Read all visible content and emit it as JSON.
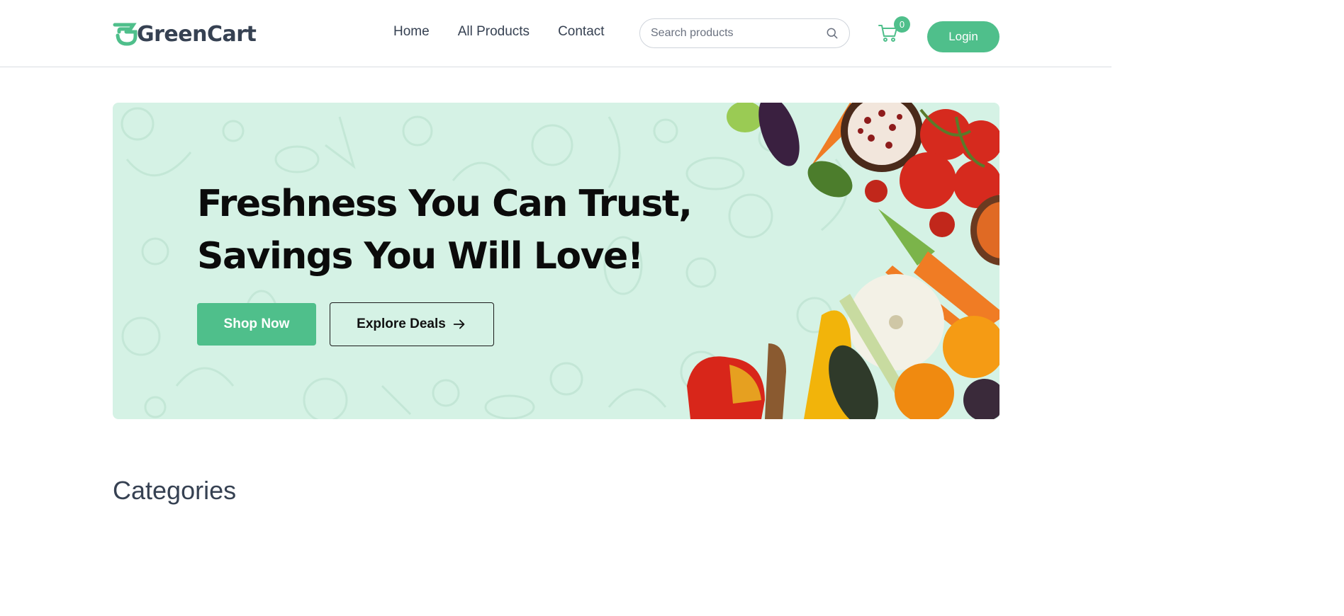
{
  "brand": {
    "name": "GreenCart",
    "logo_icon": "greencart-g-logo",
    "accent": "#4fbf8b"
  },
  "nav": {
    "links": [
      {
        "label": "Home"
      },
      {
        "label": "All Products"
      },
      {
        "label": "Contact"
      }
    ],
    "search": {
      "placeholder": "Search products",
      "icon": "search-icon"
    },
    "cart": {
      "icon": "cart-icon",
      "count": "0"
    },
    "login_label": "Login"
  },
  "hero": {
    "title_line1": "Freshness You Can Trust,",
    "title_line2": "Savings You Will Love!",
    "primary_button": "Shop Now",
    "secondary_button": "Explore Deals",
    "background": "#d5f2e5"
  },
  "sections": {
    "categories_title": "Categories"
  }
}
